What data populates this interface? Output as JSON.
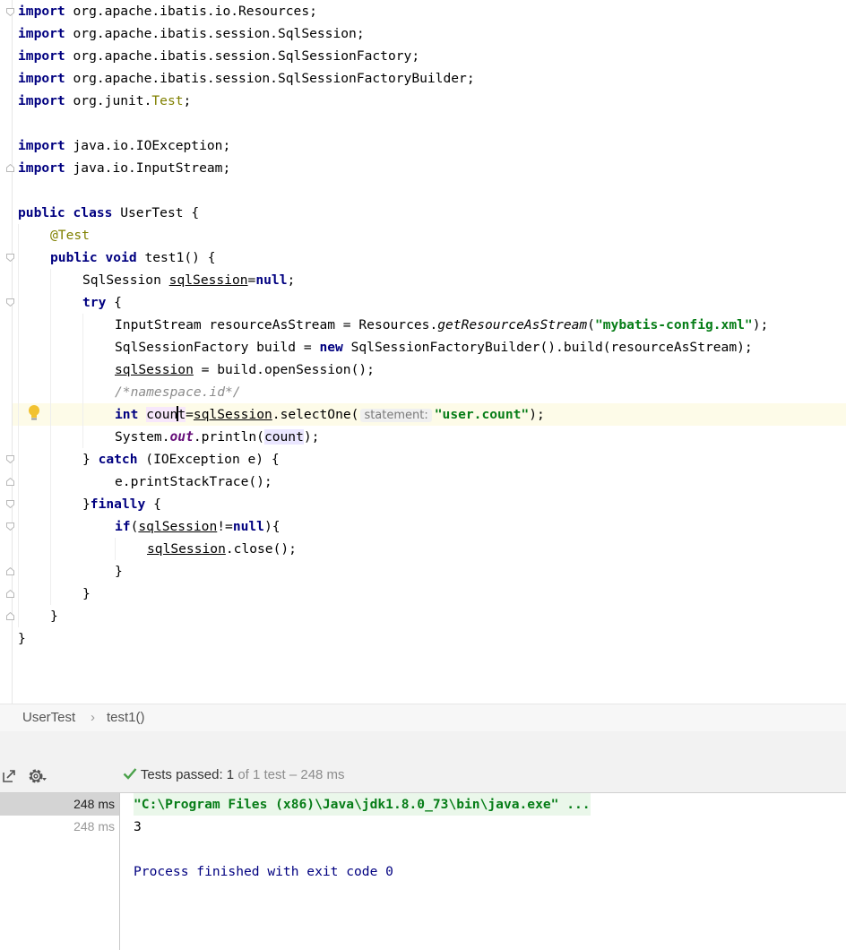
{
  "editor": {
    "imports": [
      {
        "kw": "import",
        "path": "org.apache.ibatis.io.Resources;"
      },
      {
        "kw": "import",
        "path": "org.apache.ibatis.session.SqlSession;"
      },
      {
        "kw": "import",
        "path": "org.apache.ibatis.session.SqlSessionFactory;"
      },
      {
        "kw": "import",
        "path": "org.apache.ibatis.session.SqlSessionFactoryBuilder;"
      },
      {
        "kw": "import",
        "path_a": "org.junit.",
        "path_b": "Test",
        "path_c": ";"
      },
      {
        "kw": "import",
        "path": "java.io.IOException;"
      },
      {
        "kw": "import",
        "path": "java.io.InputStream;"
      }
    ],
    "class_decl": {
      "kw": "public class",
      "name": "UserTest",
      "brace": "{"
    },
    "annotation": "@Test",
    "method_decl": {
      "kw": "public void",
      "name": "test1() {"
    },
    "l_sqlsession_type": "SqlSession",
    "l_sqlsession_var": "sqlSession",
    "l_sqlsession_eq": "=",
    "l_null": "null",
    "semi": ";",
    "l_try": "try",
    "l_try_brace": "{",
    "l_is_a": "InputStream resourceAsStream = Resources.",
    "l_is_b": "getResourceAsStream",
    "l_is_c": "(",
    "l_is_str": "\"mybatis-config.xml\"",
    "l_is_d": ");",
    "l_build_a": "SqlSessionFactory build = ",
    "l_new": "new",
    "l_build_b": " SqlSessionFactoryBuilder().build(resourceAsStream);",
    "l_open_var": "sqlSession",
    "l_open_rest": " = build.openSession();",
    "l_comment": "/*namespace.id*/",
    "l_int": "int",
    "l_count_a": "coun",
    "l_count_b": "t",
    "l_eq": "=",
    "l_sel_var": "sqlSession",
    "l_sel_rest": ".selectOne(",
    "l_hint": "statement:",
    "l_sel_str": "\"user.count\"",
    "l_sel_end": ");",
    "l_print_a": "System.",
    "l_out": "out",
    "l_print_b": ".println(",
    "l_print_var": "count",
    "l_print_c": ");",
    "l_catch_a": "} ",
    "l_catch": "catch",
    "l_catch_b": " (IOException e) {",
    "l_stack": "e.printStackTrace();",
    "l_fin_a": "}",
    "l_finally": "finally",
    "l_fin_b": " {",
    "l_if": "if",
    "l_if_a": "(",
    "l_if_var": "sqlSession",
    "l_if_b": "!=",
    "l_if_null": "null",
    "l_if_c": "){",
    "l_close_var": "sqlSession",
    "l_close_rest": ".close();",
    "close_brace": "}"
  },
  "breadcrumb": {
    "class_name": "UserTest",
    "separator": "›",
    "method_name": "test1()"
  },
  "run_panel": {
    "status_label": "Tests passed:",
    "status_count": "1",
    "status_detail": "of 1 test – 248 ms",
    "tree_rows": [
      {
        "time": "248 ms"
      },
      {
        "time": "248 ms"
      }
    ],
    "console_lines": [
      "\"C:\\Program Files (x86)\\Java\\jdk1.8.0_73\\bin\\java.exe\" ...",
      "3",
      "",
      "Process finished with exit code 0"
    ]
  },
  "colors": {
    "keyword": "#000080",
    "string": "#067d17",
    "annotation": "#808000",
    "pass": "#4aa14a",
    "console_exit": "#000080"
  },
  "icons": {
    "lightbulb": "lightbulb-icon",
    "export": "export-icon",
    "settings": "gear-icon",
    "pass": "check-icon"
  }
}
